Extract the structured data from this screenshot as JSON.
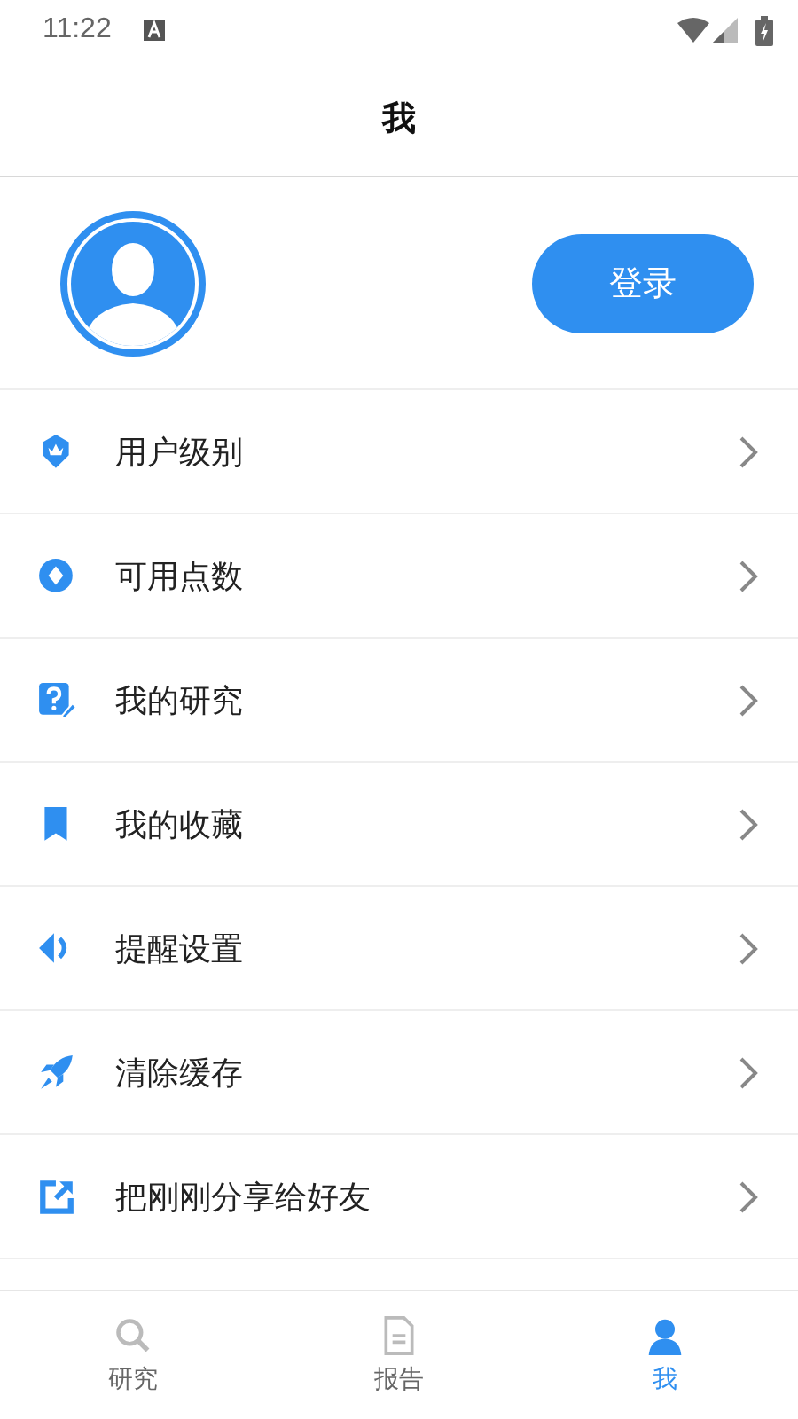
{
  "status_bar": {
    "time": "11:22"
  },
  "header": {
    "title": "我"
  },
  "profile": {
    "login_button": "登录"
  },
  "menu": [
    {
      "kind": "level",
      "label": "用户级别"
    },
    {
      "kind": "points",
      "label": "可用点数"
    },
    {
      "kind": "research",
      "label": "我的研究"
    },
    {
      "kind": "bookmark",
      "label": "我的收藏"
    },
    {
      "kind": "reminder",
      "label": "提醒设置"
    },
    {
      "kind": "rocket",
      "label": "清除缓存"
    },
    {
      "kind": "share",
      "label": "把刚刚分享给好友"
    }
  ],
  "tab_bar": [
    {
      "kind": "search",
      "label": "研究",
      "selected": false
    },
    {
      "kind": "document",
      "label": "报告",
      "selected": false
    },
    {
      "kind": "person",
      "label": "我",
      "selected": true
    }
  ]
}
